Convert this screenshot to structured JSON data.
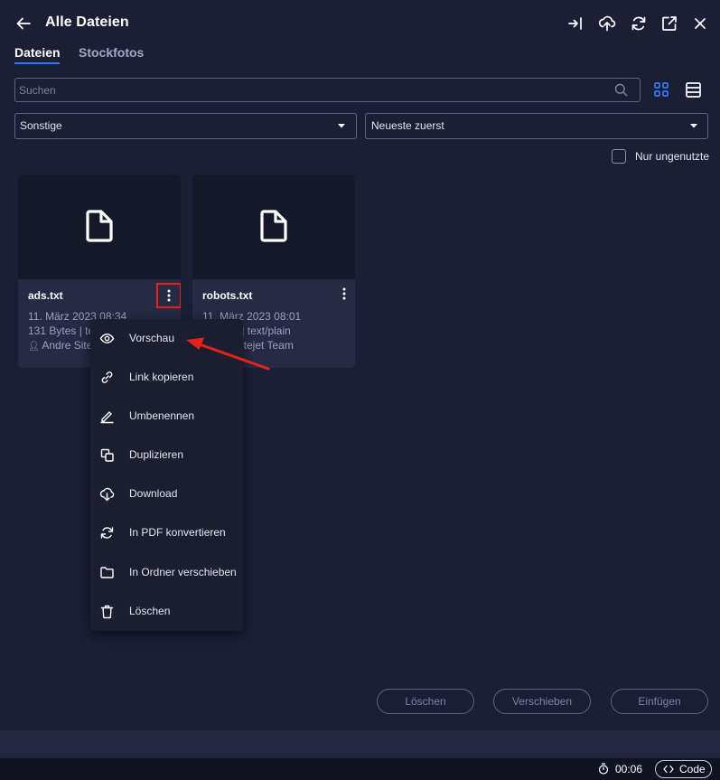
{
  "header": {
    "title": "Alle Dateien",
    "icons": [
      "back-arrow-icon",
      "import-icon",
      "upload-icon",
      "refresh-icon",
      "open-external-icon",
      "close-icon"
    ]
  },
  "tabs": [
    {
      "label": "Dateien",
      "active": true
    },
    {
      "label": "Stockfotos",
      "active": false
    }
  ],
  "search": {
    "placeholder": "Suchen"
  },
  "filters": {
    "type_select": "Sonstige",
    "sort_select": "Neueste zuerst",
    "unused_only_label": "Nur ungenutzte",
    "unused_only_checked": false
  },
  "files": [
    {
      "name": "ads.txt",
      "date": "11. März 2023 08:34",
      "info": "131 Bytes | te",
      "author": "Andre Sitej"
    },
    {
      "name": "robots.txt",
      "date": "11. März 2023 08:01",
      "info": "s | text/plain",
      "author": "Sitejet Team"
    }
  ],
  "context_menu": {
    "items": [
      {
        "label": "Vorschau",
        "icon": "eye-icon"
      },
      {
        "label": "Link kopieren",
        "icon": "link-icon"
      },
      {
        "label": "Umbenennen",
        "icon": "pencil-icon"
      },
      {
        "label": "Duplizieren",
        "icon": "duplicate-icon"
      },
      {
        "label": "Download",
        "icon": "download-icon"
      },
      {
        "label": "In PDF konvertieren",
        "icon": "convert-icon"
      },
      {
        "label": "In Ordner verschieben",
        "icon": "folder-icon"
      },
      {
        "label": "Löschen",
        "icon": "trash-icon"
      }
    ]
  },
  "actions": {
    "delete": "Löschen",
    "move": "Verschieben",
    "paste": "Einfügen"
  },
  "status": {
    "timer": "00:06",
    "code_label": "Code"
  },
  "colors": {
    "background": "#1b1e35",
    "accent": "#2f7cf6",
    "highlight": "#e3221c"
  }
}
